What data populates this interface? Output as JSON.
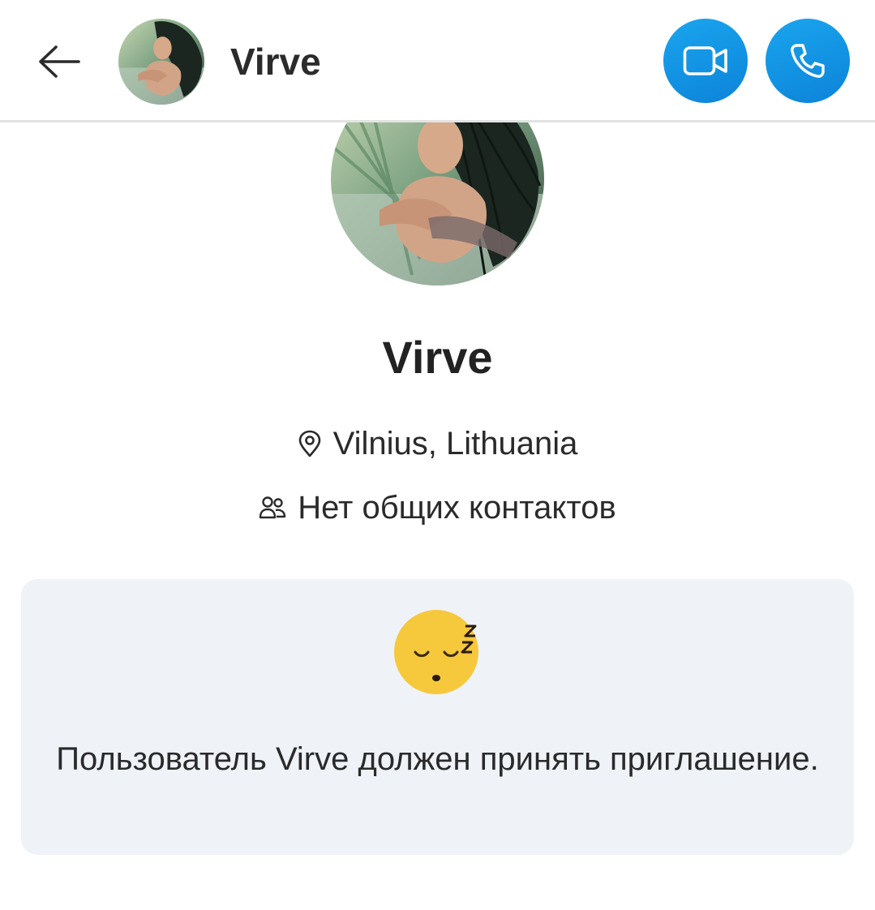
{
  "header": {
    "contact_name": "Virve",
    "back_icon": "arrow-left-icon",
    "video_icon": "video-camera-icon",
    "call_icon": "phone-icon",
    "accent_color": "#0e8fe3"
  },
  "profile": {
    "name": "Virve",
    "location_icon": "location-pin-icon",
    "location": "Vilnius, Lithuania",
    "contacts_icon": "people-icon",
    "mutual_contacts": "Нет общих контактов"
  },
  "invite_card": {
    "emoji": "sleeping-face-icon",
    "message": "Пользователь Virve должен принять приглашение.",
    "background_color": "#eff2f7"
  }
}
